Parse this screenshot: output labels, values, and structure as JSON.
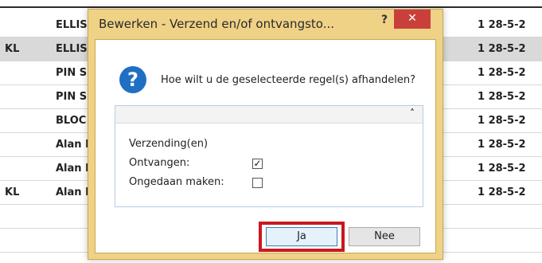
{
  "grid": {
    "rows": [
      {
        "left": "",
        "name": "ELLIS",
        "date": "1  28-5-2"
      },
      {
        "left": "KL",
        "name": "ELLIS",
        "date": "1  28-5-2"
      },
      {
        "left": "",
        "name": "PIN S",
        "date": "1  28-5-2"
      },
      {
        "left": "",
        "name": "PIN S",
        "date": "1  28-5-2"
      },
      {
        "left": "",
        "name": "BLOC",
        "date": "1  28-5-2"
      },
      {
        "left": "",
        "name": "Alan F",
        "date": "1  28-5-2"
      },
      {
        "left": "",
        "name": "Alan F",
        "date": "1  28-5-2"
      },
      {
        "left": "KL",
        "name": "Alan F",
        "date": "1  28-5-2"
      },
      {
        "left": "",
        "name": "",
        "date": ""
      },
      {
        "left": "",
        "name": "",
        "date": ""
      }
    ]
  },
  "dialog": {
    "title": "Bewerken - Verzend en/of ontvangsto...",
    "help_label": "?",
    "close_label": "✕",
    "question_icon": "?",
    "question": "Hoe wilt u de geselecteerde regel(s) afhandelen?",
    "collapse_icon": "˄",
    "section_label": "Verzending(en)",
    "options": [
      {
        "label": "Ontvangen:",
        "checked": true,
        "mark": "✓"
      },
      {
        "label": "Ongedaan maken:",
        "checked": false,
        "mark": ""
      }
    ],
    "buttons": {
      "yes": "Ja",
      "no": "Nee"
    },
    "colors": {
      "frame": "#efd286",
      "close": "#c9403a",
      "highlight": "#c9181e",
      "question_icon": "#1f6fc4"
    }
  }
}
